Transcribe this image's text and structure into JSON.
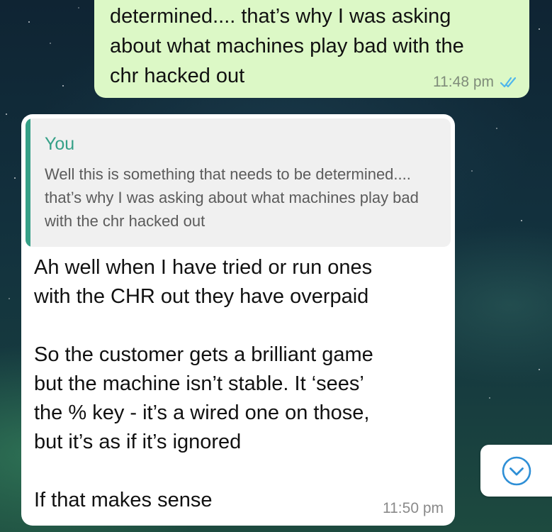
{
  "messages": {
    "outgoing": {
      "text": "determined.... that’s why I was asking\nabout what machines play bad with the\nchr hacked out",
      "time": "11:48 pm",
      "status_icon": "double-check-read-icon"
    },
    "incoming": {
      "quote": {
        "author": "You",
        "text": "Well this is something that needs to be determined.... that’s why I was asking about what machines play bad with the chr hacked out"
      },
      "text": "Ah well when I have tried or run ones\nwith the CHR out they have overpaid\n\nSo the customer gets a brilliant game\nbut the machine isn’t stable. It ‘sees’\nthe % key - it’s a wired one on those,\nbut it’s as if it’s ignored\n\nIf that makes sense",
      "time": "11:50 pm"
    }
  },
  "scroll_button": {
    "icon": "chevron-down-circle-icon"
  },
  "colors": {
    "outgoing_bubble": "#dcf8c6",
    "incoming_bubble": "#ffffff",
    "quote_accent": "#35a087",
    "read_ticks": "#4fb6ec"
  }
}
